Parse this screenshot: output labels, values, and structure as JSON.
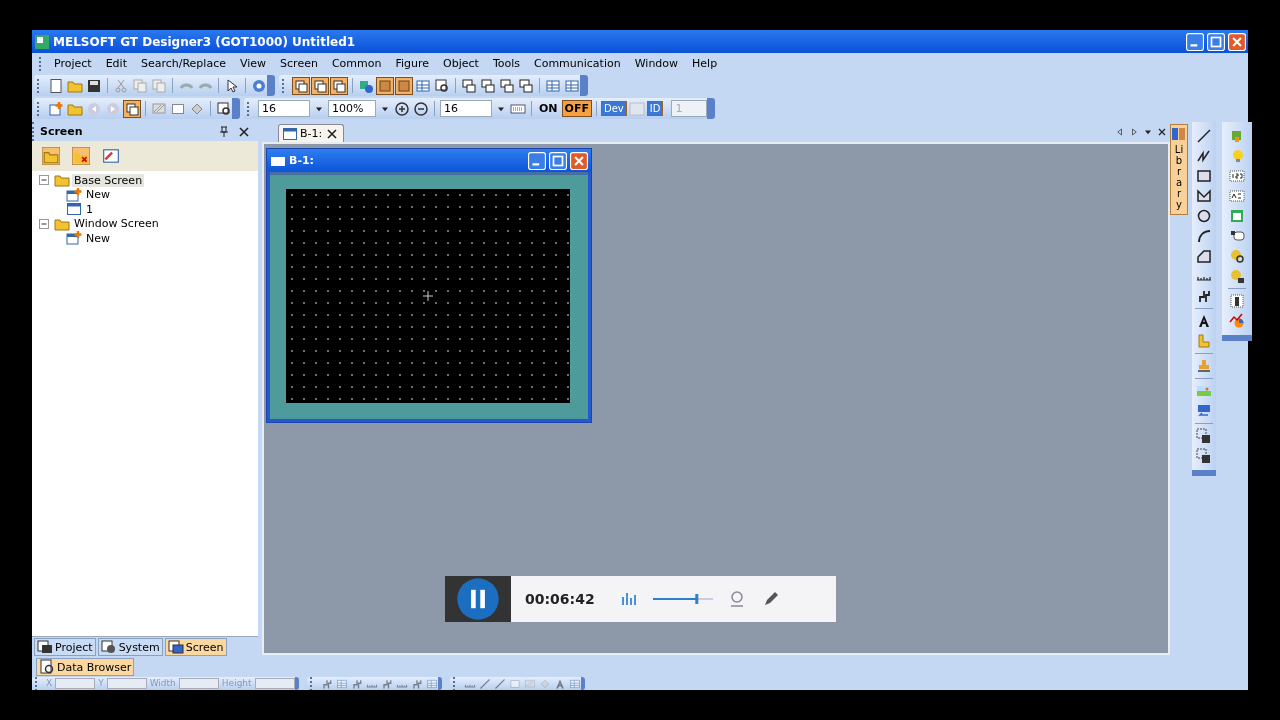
{
  "window": {
    "title": "MELSOFT GT Designer3 (GOT1000) Untitled1"
  },
  "menu": [
    "Project",
    "Edit",
    "Search/Replace",
    "View",
    "Screen",
    "Common",
    "Figure",
    "Object",
    "Tools",
    "Communication",
    "Window",
    "Help"
  ],
  "toolbar": {
    "font_size": "16",
    "zoom": "100%",
    "grid_size": "16",
    "toggles": [
      {
        "label": "ON",
        "selected": false
      },
      {
        "label": "OFF",
        "selected": true
      }
    ],
    "display_buttons": [
      {
        "label": "Dev",
        "selected": true
      },
      {
        "label": "ID",
        "selected": true
      }
    ],
    "layer": {
      "value": "1",
      "disabled": true
    }
  },
  "screen_panel": {
    "title": "Screen",
    "tree": [
      {
        "label": "Base Screen",
        "kind": "folder",
        "expanded": true,
        "selected": true,
        "children": [
          {
            "label": "New",
            "kind": "new",
            "selected": false
          },
          {
            "label": "1",
            "kind": "screen",
            "selected": false
          }
        ]
      },
      {
        "label": "Window Screen",
        "kind": "folder",
        "expanded": true,
        "selected": false,
        "children": [
          {
            "label": "New",
            "kind": "new",
            "selected": false
          }
        ]
      }
    ]
  },
  "panel_tabs": [
    {
      "label": "Project",
      "selected": false
    },
    {
      "label": "System",
      "selected": false
    },
    {
      "label": "Screen",
      "selected": true
    }
  ],
  "dock_tabs": [
    {
      "label": "Data Browser",
      "selected": true
    }
  ],
  "editor": {
    "tabs": [
      {
        "label": "B-1:",
        "selected": true
      }
    ],
    "window": {
      "title": "B-1:"
    }
  },
  "library_tab": {
    "label": "Library"
  },
  "property_bar": [
    {
      "label": "X",
      "disabled": true
    },
    {
      "label": "Y",
      "disabled": true
    },
    {
      "label": "Width",
      "disabled": true
    },
    {
      "label": "Height",
      "disabled": true
    }
  ],
  "recorder": {
    "time": "00:06:42",
    "volume": {
      "level": 0.73
    }
  }
}
